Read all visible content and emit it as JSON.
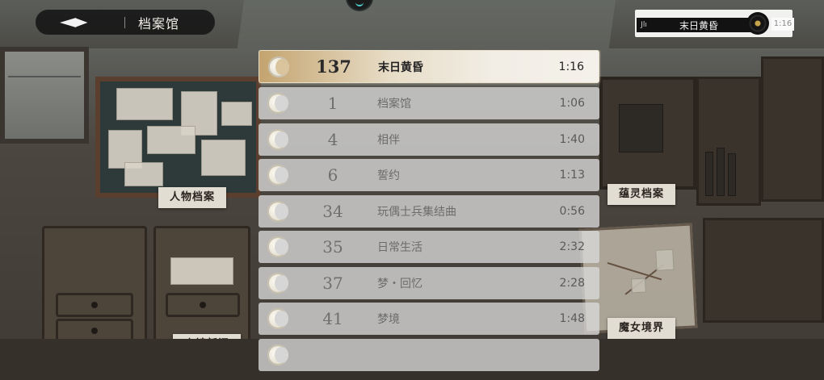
{
  "header": {
    "title": "档案馆"
  },
  "now_playing": {
    "title": "末日黄昏",
    "time": "1:16",
    "bars_glyph": "Jlı"
  },
  "tracks": [
    {
      "number": "137",
      "name": "末日黄昏",
      "duration": "1:16",
      "active": true
    },
    {
      "number": "1",
      "name": "档案馆",
      "duration": "1:06"
    },
    {
      "number": "4",
      "name": "相伴",
      "duration": "1:40"
    },
    {
      "number": "6",
      "name": "誓约",
      "duration": "1:13"
    },
    {
      "number": "34",
      "name": "玩偶士兵集结曲",
      "duration": "0:56"
    },
    {
      "number": "35",
      "name": "日常生活",
      "duration": "2:32"
    },
    {
      "number": "37",
      "name": "梦・回忆",
      "duration": "2:28"
    },
    {
      "number": "41",
      "name": "梦境",
      "duration": "1:48"
    },
    {
      "number": "",
      "name": "",
      "duration": ""
    }
  ],
  "background_labels": {
    "characters": "人物档案",
    "spirits": "蕴灵档案",
    "news": "小镇新闻",
    "witch": "魔女境界"
  }
}
